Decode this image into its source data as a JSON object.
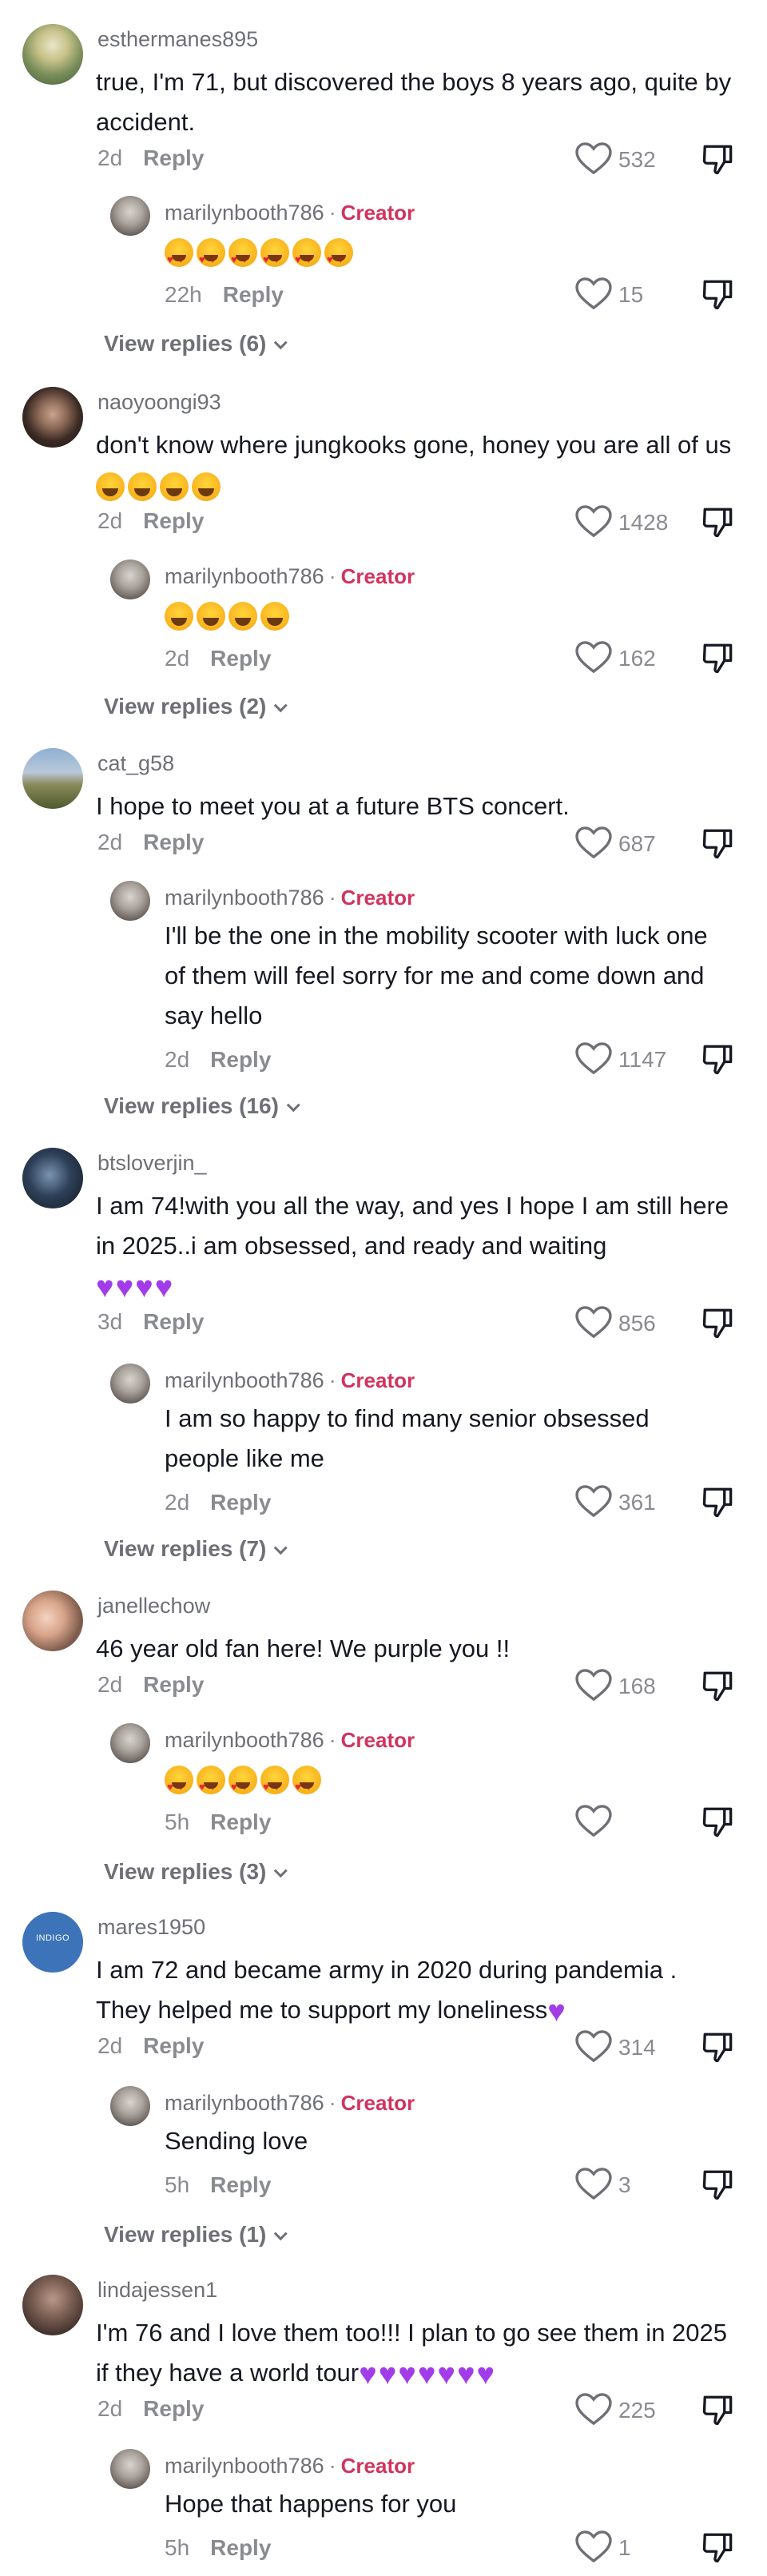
{
  "labels": {
    "reply": "Reply",
    "creator": "Creator",
    "dot": "·"
  },
  "comments": [
    {
      "username": "esthermanes895",
      "text": "true, I'm 71, but discovered the boys 8 years ago, quite by accident.",
      "time": "2d",
      "likes": "532",
      "reply": {
        "username": "marilynbooth786",
        "emoji": "hearteyes",
        "emoji_count": 6,
        "text": "",
        "time": "22h",
        "likes": "15"
      },
      "view_replies": "View replies (6)"
    },
    {
      "username": "naoyoongi93",
      "text": "don't know where jungkooks gone, honey you are all of us",
      "text_emoji": "laugh",
      "text_emoji_count": 4,
      "time": "2d",
      "likes": "1428",
      "reply": {
        "username": "marilynbooth786",
        "emoji": "laugh",
        "emoji_count": 4,
        "text": "",
        "time": "2d",
        "likes": "162"
      },
      "view_replies": "View replies (2)"
    },
    {
      "username": "cat_g58",
      "text": "I hope to meet you at a future BTS concert.",
      "time": "2d",
      "likes": "687",
      "reply": {
        "username": "marilynbooth786",
        "text": "I'll be the one in the mobility scooter with luck one of them will feel sorry for me and come down and say hello",
        "time": "2d",
        "likes": "1147"
      },
      "view_replies": "View replies (16)"
    },
    {
      "username": "btsloverjin_",
      "text": "I am 74!with you all the way, and yes I hope I am still here in 2025..i am obsessed, and ready and waiting",
      "text_emoji": "purple",
      "text_emoji_count": 4,
      "time": "3d",
      "likes": "856",
      "reply": {
        "username": "marilynbooth786",
        "text": "I am so happy to find many senior obsessed people like me",
        "time": "2d",
        "likes": "361"
      },
      "view_replies": "View replies (7)"
    },
    {
      "username": "janellechow",
      "text": "46 year old fan here! We purple you !!",
      "time": "2d",
      "likes": "168",
      "reply": {
        "username": "marilynbooth786",
        "emoji": "hearteyes",
        "emoji_count": 5,
        "text": "",
        "time": "5h",
        "likes": ""
      },
      "view_replies": "View replies (3)"
    },
    {
      "username": "mares1950",
      "text": "I am 72 and became army in 2020 during pandemia . They helped me to support my loneliness",
      "text_emoji": "purple",
      "text_emoji_count": 1,
      "time": "2d",
      "likes": "314",
      "reply": {
        "username": "marilynbooth786",
        "text": "Sending love",
        "time": "5h",
        "likes": "3"
      },
      "view_replies": "View replies (1)"
    },
    {
      "username": "lindajessen1",
      "text": "I'm 76 and I love them too!!! I plan to go see them in 2025 if they have a world tour",
      "text_emoji": "purple",
      "text_emoji_count": 7,
      "time": "2d",
      "likes": "225",
      "reply": {
        "username": "marilynbooth786",
        "text": "Hope that happens for you",
        "time": "5h",
        "likes": "1"
      },
      "view_replies": ""
    }
  ],
  "avatar_badge_mares1950": "INDIGO",
  "colors": {
    "creator": "#d0345f",
    "purple_heart": "#a23be8",
    "text": "#161823",
    "muted": "#8a8b91"
  }
}
